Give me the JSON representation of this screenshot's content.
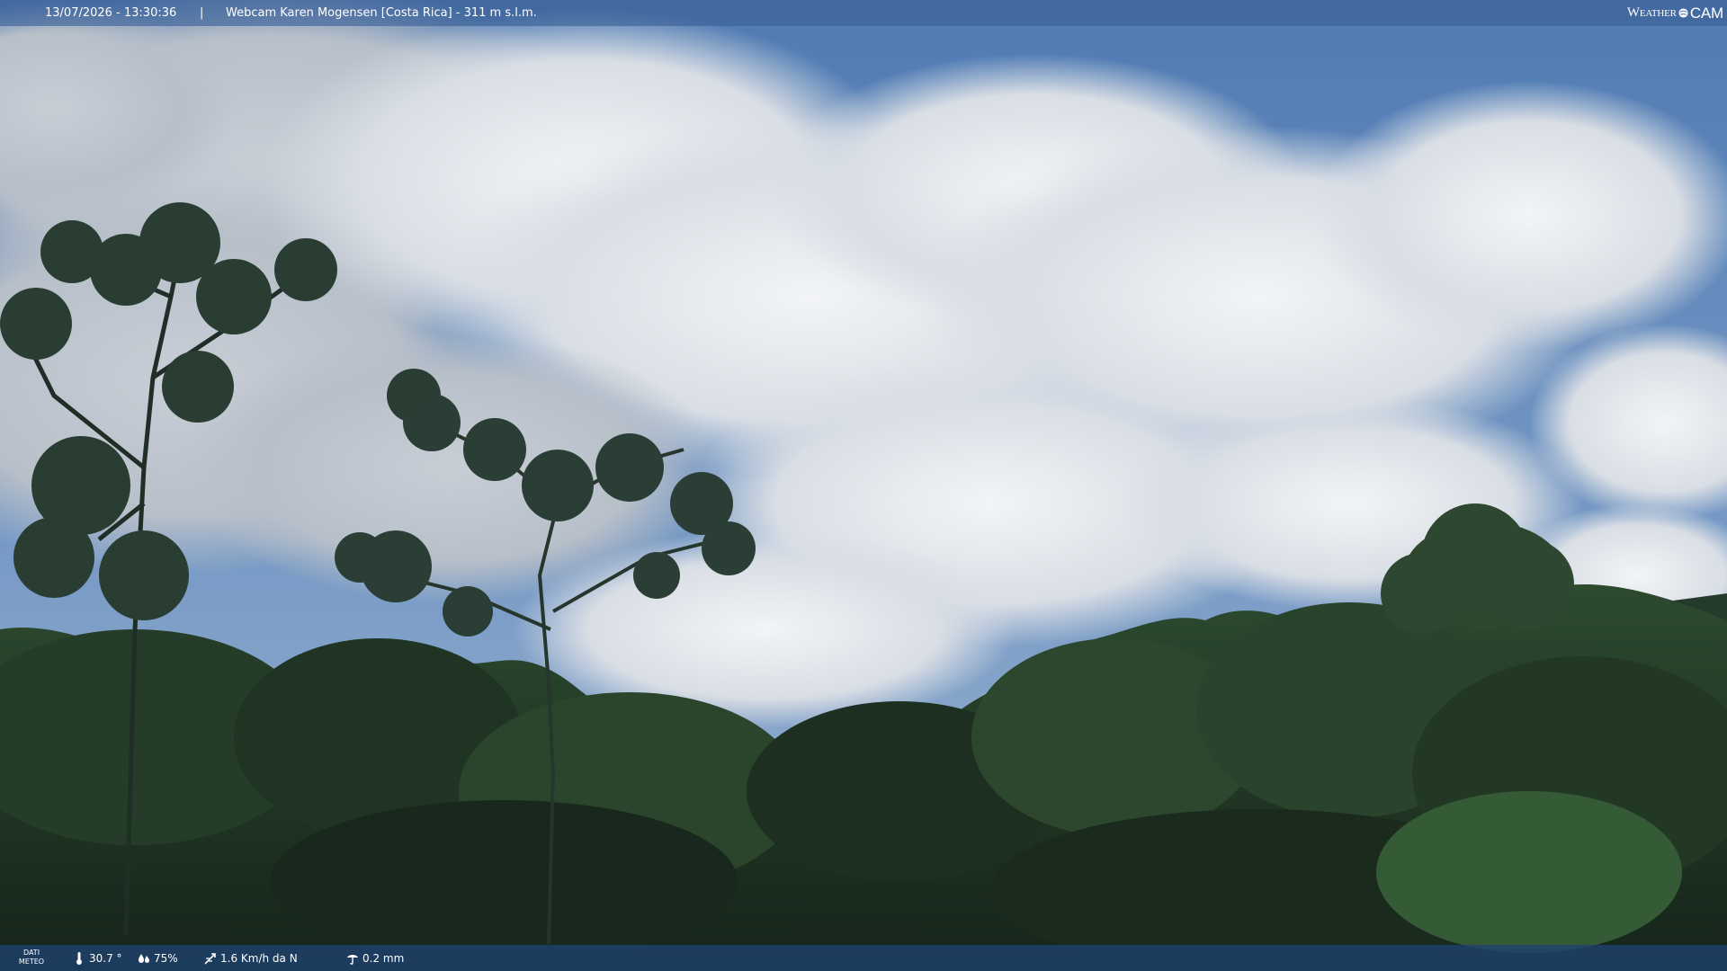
{
  "header": {
    "datetime": "13/07/2026 - 13:30:36",
    "separator": "|",
    "camera_title": "Webcam Karen Mogensen [Costa Rica]  - 311 m s.l.m.",
    "brand_weather": "Weather",
    "brand_cam": "CAM"
  },
  "weather": {
    "label_line1": "DATI",
    "label_line2": "METEO",
    "temperature": "30.7 °",
    "humidity": "75%",
    "wind": "1.6 Km/h da N",
    "rain": "0.2 mm"
  },
  "colors": {
    "sky": "#5f86b8",
    "cloud": "#e8ecf1",
    "canopy_dark": "#1e3222",
    "canopy_mid": "#2f4a30",
    "bar_top": "#3a6096",
    "bar_bottom": "#1e426e"
  },
  "icons": {
    "temperature": "thermometer-icon",
    "humidity": "droplets-icon",
    "wind": "wind-direction-icon",
    "rain": "rain-gauge-icon",
    "brand": "globe-icon"
  }
}
